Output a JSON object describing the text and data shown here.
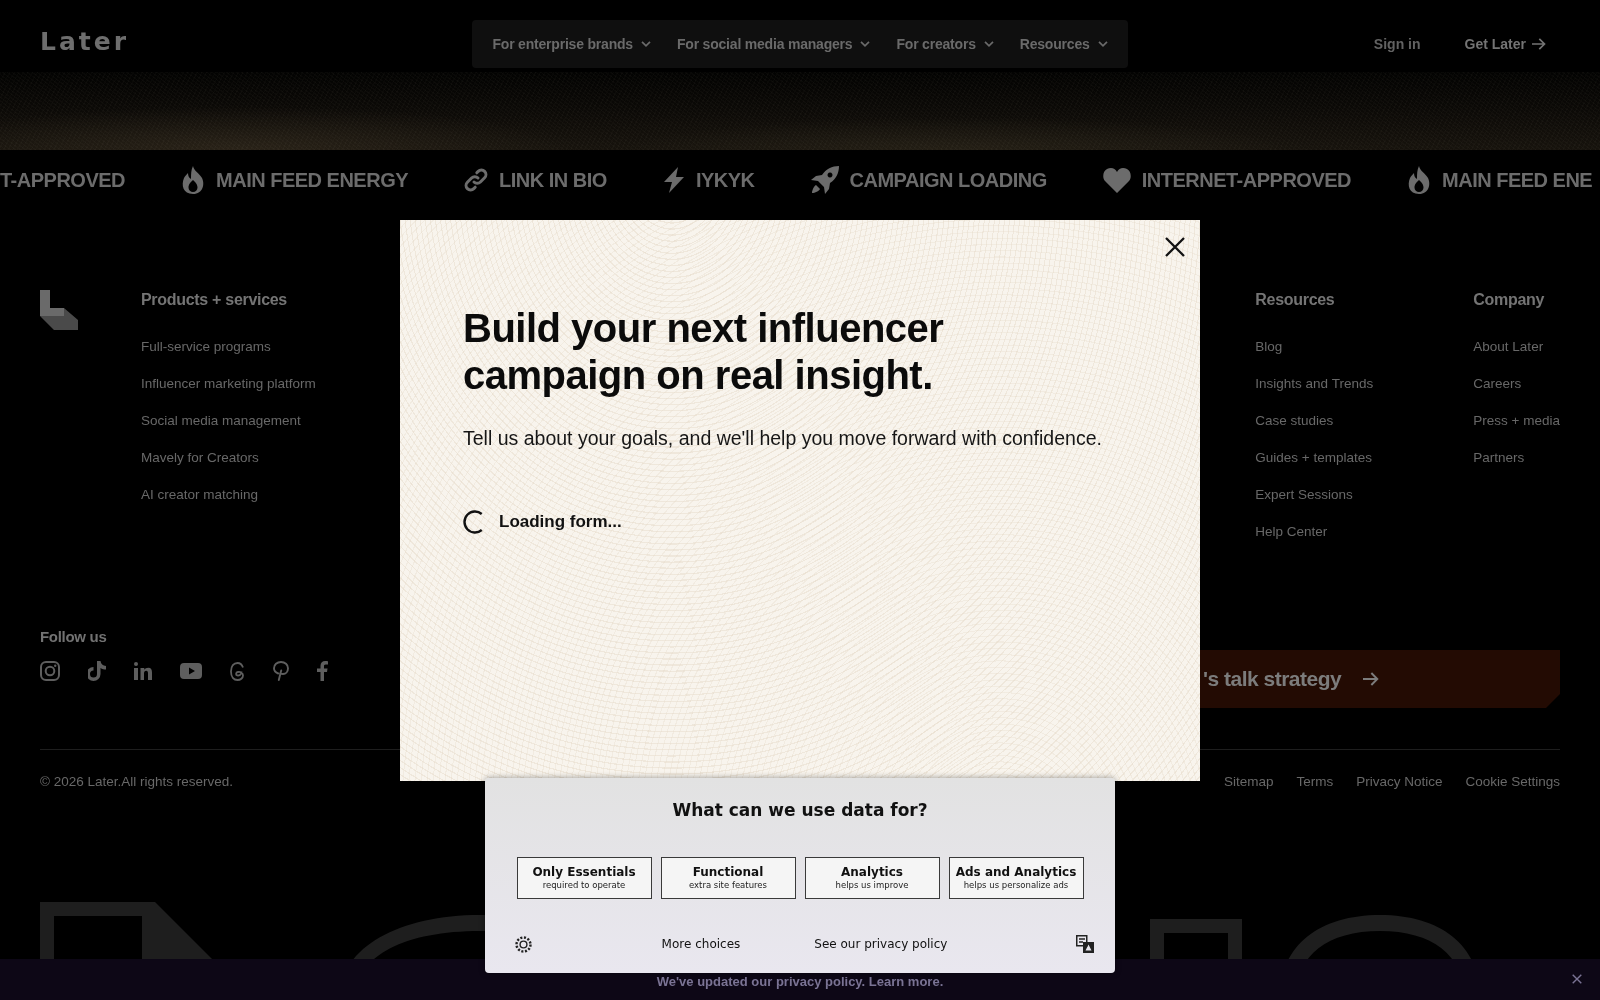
{
  "header": {
    "logo": "Later",
    "nav": [
      "For enterprise brands",
      "For social media managers",
      "For creators",
      "Resources"
    ],
    "sign_in": "Sign in",
    "cta": "Get Later"
  },
  "ticker": [
    {
      "kind": "plain",
      "label": "T-APPROVED"
    },
    {
      "kind": "flame",
      "label": "MAIN FEED ENERGY"
    },
    {
      "kind": "link",
      "label": "LINK IN BIO"
    },
    {
      "kind": "bolt",
      "label": "IYKYK"
    },
    {
      "kind": "rocket",
      "label": "CAMPAIGN LOADING"
    },
    {
      "kind": "heart",
      "label": "INTERNET-APPROVED"
    },
    {
      "kind": "flame",
      "label": "MAIN FEED ENE"
    }
  ],
  "footer": {
    "columns": [
      {
        "heading": "Products + services",
        "links": [
          "Full-service programs",
          "Influencer marketing platform",
          "Social media management",
          "Mavely for Creators",
          "AI creator matching"
        ]
      },
      {
        "heading": "Resources",
        "links": [
          "Blog",
          "Insights and Trends",
          "Case studies",
          "Guides + templates",
          "Expert Sessions",
          "Help Center"
        ]
      },
      {
        "heading": "Company",
        "links": [
          "About Later",
          "Careers",
          "Press + media",
          "Partners"
        ]
      }
    ],
    "follow_us": "Follow us",
    "cta": "'s talk strategy",
    "copyright": "© 2026 Later.All rights reserved.",
    "legal_links": [
      "Sitemap",
      "Terms",
      "Privacy Notice",
      "Cookie Settings"
    ]
  },
  "modal": {
    "title": "Build your next influencer campaign on real insight.",
    "subtitle": "Tell us about your goals, and we'll help you move forward with confidence.",
    "loading": "Loading form..."
  },
  "cookie_banner": {
    "title": "What can we use data for?",
    "options": [
      {
        "label": "Only Essentials",
        "detail": "required to operate"
      },
      {
        "label": "Functional",
        "detail": "extra site features"
      },
      {
        "label": "Analytics",
        "detail": "helps us improve"
      },
      {
        "label": "Ads and Analytics",
        "detail": "helps us personalize ads"
      }
    ],
    "more_choices": "More choices",
    "privacy_link": "See our privacy policy"
  },
  "notice_bar": {
    "text": "We've updated our privacy policy. Learn more."
  }
}
